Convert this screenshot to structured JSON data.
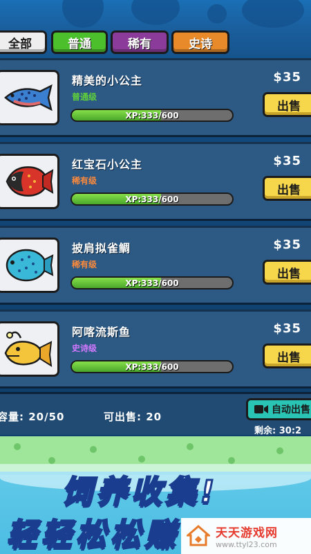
{
  "tabs": [
    {
      "label": "全部"
    },
    {
      "label": "普通"
    },
    {
      "label": "稀有"
    },
    {
      "label": "史诗"
    }
  ],
  "fish": [
    {
      "name": "精美的小公主",
      "rarity": "普通级",
      "rarity_type": "common",
      "xp": "XP:333/600",
      "xp_fraction": 0.555,
      "price": "$35",
      "sell_label": "出售",
      "icon": "blue-spotted-fish-icon"
    },
    {
      "name": "红宝石小公主",
      "rarity": "稀有级",
      "rarity_type": "rare",
      "xp": "XP:333/600",
      "xp_fraction": 0.555,
      "price": "$35",
      "sell_label": "出售",
      "icon": "red-piranha-fish-icon"
    },
    {
      "name": "披肩拟雀鲷",
      "rarity": "稀有级",
      "rarity_type": "rare",
      "xp": "XP:333/600",
      "xp_fraction": 0.555,
      "price": "$35",
      "sell_label": "出售",
      "icon": "blue-round-fish-icon"
    },
    {
      "name": "阿喀流斯鱼",
      "rarity": "史诗级",
      "rarity_type": "epic",
      "xp": "XP:333/600",
      "xp_fraction": 0.555,
      "price": "$35",
      "sell_label": "出售",
      "icon": "yellow-anglerfish-icon"
    }
  ],
  "status": {
    "capacity": "容量:  20/50",
    "sellable": "可出售:  20",
    "auto_sell": "自动出售",
    "remaining": "剩余: 30:2"
  },
  "promo": {
    "line1": "饲养收集!",
    "line2": "轻轻松松赚"
  },
  "watermark": {
    "title": "天天游戏网",
    "url": "www.ttyl23.com"
  },
  "colors": {
    "common": "#5fcf3a",
    "rare": "#ff8a3b",
    "epic": "#d278ff",
    "sell_button": "#f6d64a"
  }
}
